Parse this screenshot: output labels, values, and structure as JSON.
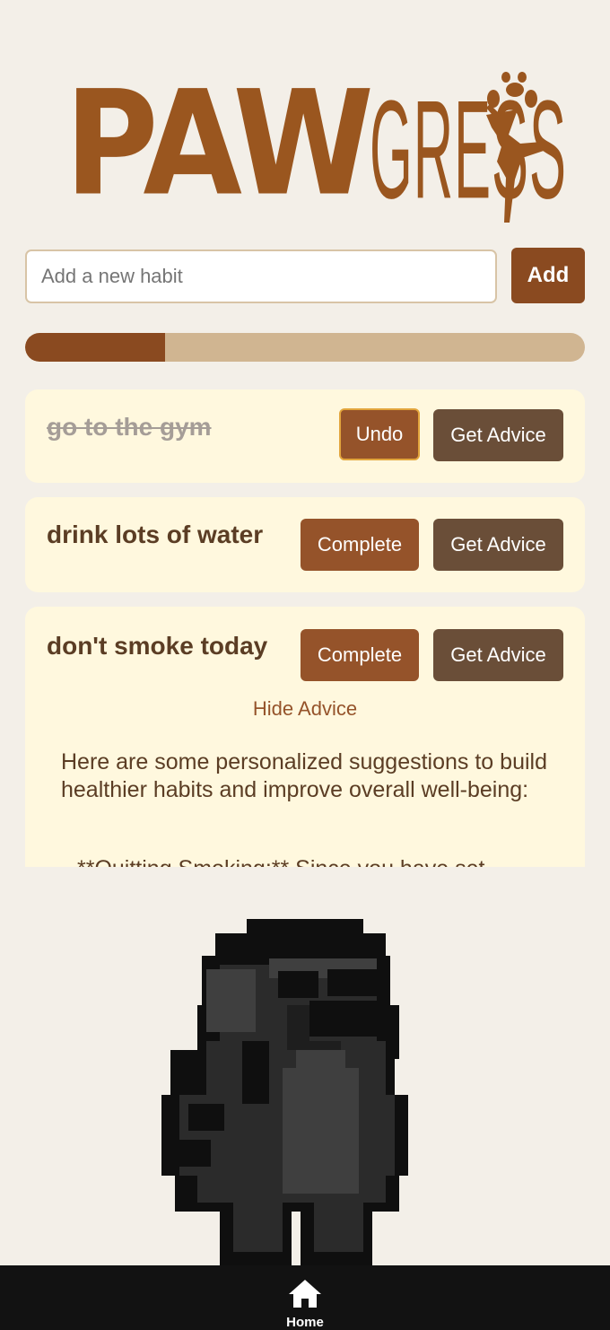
{
  "logo": {
    "part1": "PAW",
    "part2": "GRESS"
  },
  "add_habit": {
    "placeholder": "Add a new habit",
    "button_label": "Add"
  },
  "progress": {
    "value_fraction": 0.25
  },
  "habits": [
    {
      "title": "go to the gym",
      "completed": true,
      "toggle_label": "Undo",
      "advice_label": "Get Advice"
    },
    {
      "title": "drink lots of water",
      "completed": false,
      "toggle_label": "Complete",
      "advice_label": "Get Advice"
    },
    {
      "title": "don't smoke today",
      "completed": false,
      "toggle_label": "Complete",
      "advice_label": "Get Advice",
      "hide_advice_label": "Hide Advice",
      "advice_text": "Here are some personalized suggestions to build healthier habits and improve overall well-being:",
      "advice_more": "**Quitting Smoking:** Since you have set"
    }
  ],
  "nav": {
    "home_label": "Home"
  },
  "colors": {
    "accent": "#8a4a20",
    "background": "#f3efe8",
    "card": "#fff8de",
    "nav": "#121212"
  },
  "icons": {
    "home": "home-icon",
    "paw": "paw-icon"
  }
}
